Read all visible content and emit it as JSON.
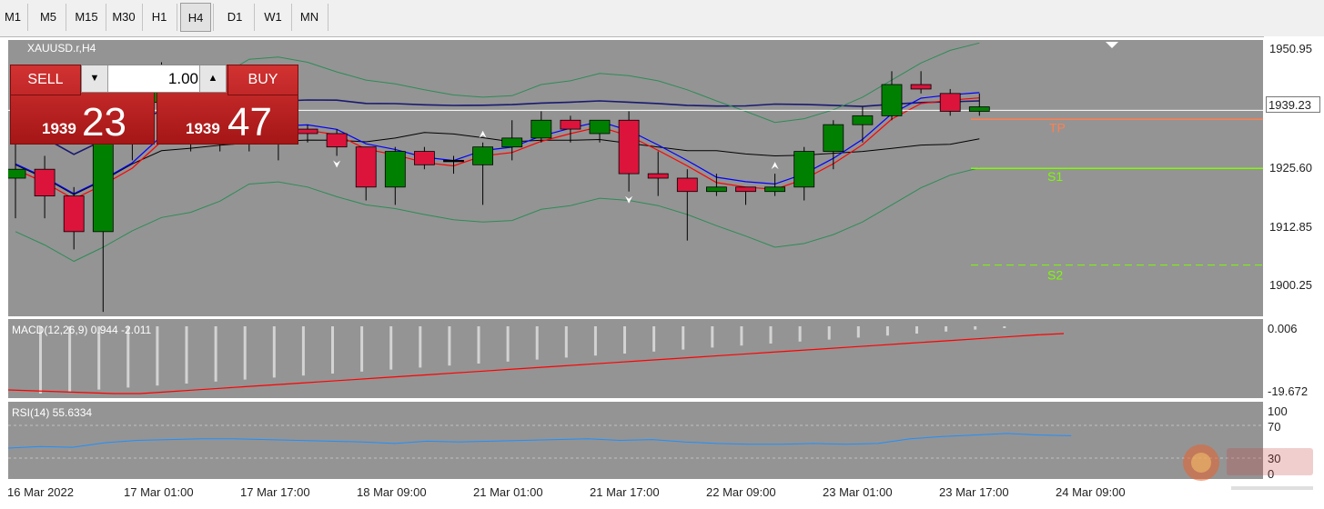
{
  "toolbar": {
    "timeframes": [
      {
        "label": "M1",
        "active": false
      },
      {
        "label": "M5",
        "active": false
      },
      {
        "label": "M15",
        "active": false
      },
      {
        "label": "M30",
        "active": false
      },
      {
        "label": "H1",
        "active": false
      },
      {
        "label": "H4",
        "active": true
      },
      {
        "label": "D1",
        "active": false
      },
      {
        "label": "W1",
        "active": false
      },
      {
        "label": "MN",
        "active": false
      }
    ]
  },
  "chart": {
    "symbol_label": "XAUUSD.r,H4",
    "price_axis": [
      "1950.95",
      "1939.23",
      "1925.60",
      "1912.85",
      "1900.25"
    ],
    "current_price": "1939.23",
    "level_labels": {
      "tp": "TP",
      "s1": "S1",
      "s2": "S2"
    },
    "time_axis": [
      "16 Mar 2022",
      "17 Mar 01:00",
      "17 Mar 17:00",
      "18 Mar 09:00",
      "21 Mar 01:00",
      "21 Mar 17:00",
      "22 Mar 09:00",
      "23 Mar 01:00",
      "23 Mar 17:00",
      "24 Mar 09:00"
    ],
    "colors": {
      "bull": "#008000",
      "bear": "#dc143c",
      "background": "#949494",
      "ma_slow": "#191970",
      "ma_red": "#ff0000",
      "ma_blue": "#0000ff",
      "ma_black": "#000000",
      "bands": "#2e8b57",
      "s_level": "#7cfc00",
      "tp_level": "#ff7f50"
    }
  },
  "trade_panel": {
    "sell_label": "SELL",
    "buy_label": "BUY",
    "lot_value": "1.00",
    "sell_price_prefix": "1939",
    "sell_price_main": "23",
    "buy_price_prefix": "1939",
    "buy_price_main": "47"
  },
  "macd": {
    "label": "MACD(12,26,9) 0.944 -2.011",
    "axis": [
      "0.006",
      "-19.672"
    ]
  },
  "rsi": {
    "label": "RSI(14) 55.6334",
    "axis": [
      "100",
      "70",
      "30",
      "0"
    ]
  },
  "chart_data": {
    "type": "candlestick",
    "y_range": [
      1893.0,
      1955.0
    ],
    "candles": [
      {
        "o": 1924,
        "h": 1935,
        "l": 1915,
        "c": 1926
      },
      {
        "o": 1926,
        "h": 1929,
        "l": 1915,
        "c": 1920
      },
      {
        "o": 1920,
        "h": 1922,
        "l": 1908,
        "c": 1912
      },
      {
        "o": 1912,
        "h": 1938,
        "l": 1894,
        "c": 1932
      },
      {
        "o": 1932,
        "h": 1946,
        "l": 1928,
        "c": 1941
      },
      {
        "o": 1941,
        "h": 1950,
        "l": 1937,
        "c": 1944
      },
      {
        "o": 1944,
        "h": 1947,
        "l": 1930,
        "c": 1933
      },
      {
        "o": 1933,
        "h": 1937,
        "l": 1930,
        "c": 1935
      },
      {
        "o": 1935,
        "h": 1938,
        "l": 1930,
        "c": 1935
      },
      {
        "o": 1935,
        "h": 1943,
        "l": 1928,
        "c": 1935
      },
      {
        "o": 1935,
        "h": 1936,
        "l": 1932,
        "c": 1934
      },
      {
        "o": 1934,
        "h": 1935,
        "l": 1929,
        "c": 1931
      },
      {
        "o": 1931,
        "h": 1931,
        "l": 1919,
        "c": 1922
      },
      {
        "o": 1922,
        "h": 1931,
        "l": 1918,
        "c": 1930
      },
      {
        "o": 1930,
        "h": 1931,
        "l": 1926,
        "c": 1927
      },
      {
        "o": 1928,
        "h": 1929,
        "l": 1925,
        "c": 1928
      },
      {
        "o": 1927,
        "h": 1932,
        "l": 1918,
        "c": 1931
      },
      {
        "o": 1931,
        "h": 1937,
        "l": 1928,
        "c": 1933
      },
      {
        "o": 1933,
        "h": 1939,
        "l": 1932,
        "c": 1937
      },
      {
        "o": 1937,
        "h": 1938,
        "l": 1932,
        "c": 1935
      },
      {
        "o": 1934,
        "h": 1937,
        "l": 1932,
        "c": 1937
      },
      {
        "o": 1937,
        "h": 1939,
        "l": 1921,
        "c": 1925
      },
      {
        "o": 1925,
        "h": 1930,
        "l": 1920,
        "c": 1924
      },
      {
        "o": 1924,
        "h": 1926,
        "l": 1910,
        "c": 1921
      },
      {
        "o": 1921,
        "h": 1925,
        "l": 1920,
        "c": 1922
      },
      {
        "o": 1922,
        "h": 1922,
        "l": 1918,
        "c": 1921
      },
      {
        "o": 1921,
        "h": 1925,
        "l": 1920,
        "c": 1922
      },
      {
        "o": 1922,
        "h": 1931,
        "l": 1919,
        "c": 1930
      },
      {
        "o": 1930,
        "h": 1937,
        "l": 1926,
        "c": 1936
      },
      {
        "o": 1936,
        "h": 1940,
        "l": 1932,
        "c": 1938
      },
      {
        "o": 1938,
        "h": 1948,
        "l": 1937,
        "c": 1945
      },
      {
        "o": 1945,
        "h": 1948,
        "l": 1943,
        "c": 1944
      },
      {
        "o": 1943,
        "h": 1944,
        "l": 1938,
        "c": 1939
      },
      {
        "o": 1939,
        "h": 1943,
        "l": 1938,
        "c": 1940
      }
    ]
  }
}
